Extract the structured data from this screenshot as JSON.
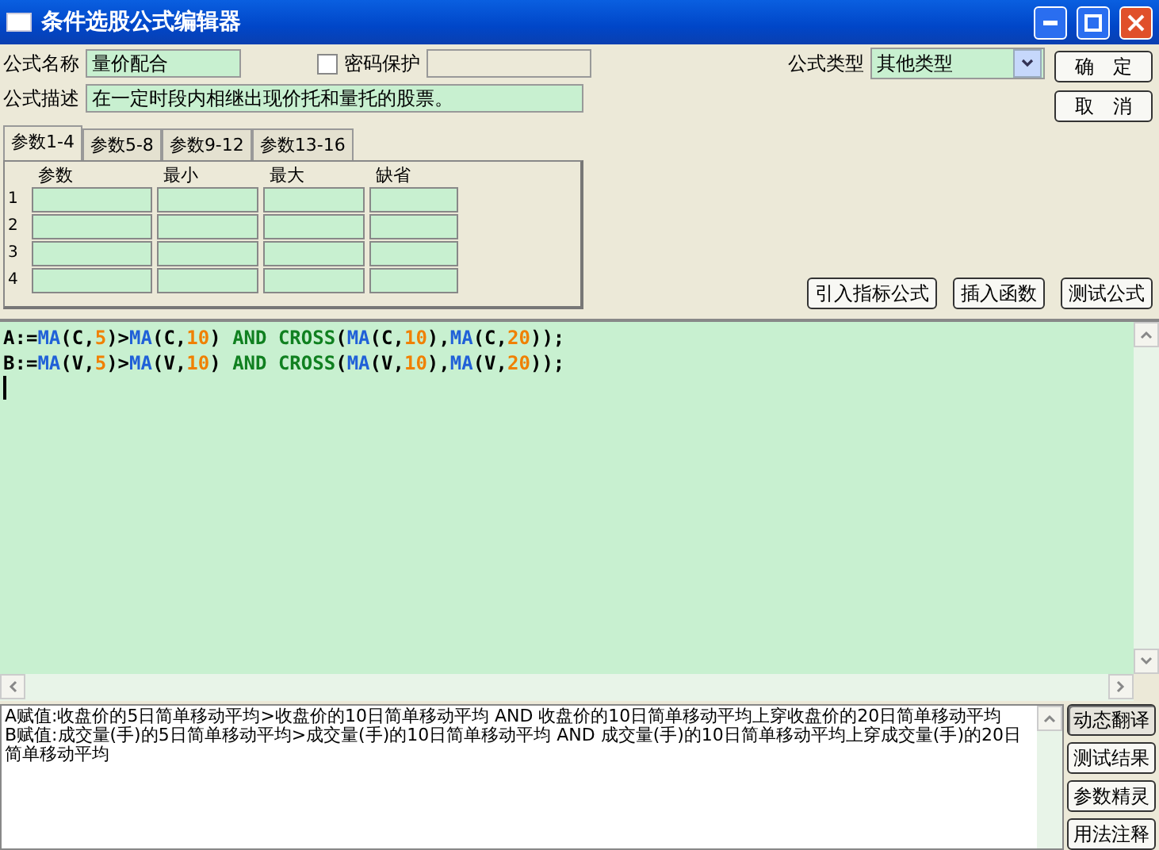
{
  "window": {
    "title": "条件选股公式编辑器"
  },
  "form": {
    "name_label": "公式名称",
    "name_value": "量价配合",
    "password": {
      "label": "密码保护",
      "checked": false
    },
    "type_label": "公式类型",
    "type_value": "其他类型",
    "desc_label": "公式描述",
    "desc_value": "在一定时段内相继出现价托和量托的股票。"
  },
  "dialog_buttons": [
    "确　定",
    "取　消"
  ],
  "tabs": [
    {
      "label": "参数1-4",
      "selected": true
    },
    {
      "label": "参数5-8",
      "selected": false
    },
    {
      "label": "参数9-12",
      "selected": false
    },
    {
      "label": "参数13-16",
      "selected": false
    }
  ],
  "params": {
    "columns": [
      "参数",
      "最小",
      "最大",
      "缺省"
    ],
    "rows": [
      "1",
      "2",
      "3",
      "4"
    ]
  },
  "tool_buttons": [
    "引入指标公式",
    "插入函数",
    "测试公式"
  ],
  "editor": {
    "lines": [
      [
        {
          "kind": "plain",
          "text": "A:="
        },
        {
          "kind": "func",
          "text": "MA"
        },
        {
          "kind": "plain",
          "text": "(C,"
        },
        {
          "kind": "number",
          "text": "5"
        },
        {
          "kind": "plain",
          "text": ")>"
        },
        {
          "kind": "func",
          "text": "MA"
        },
        {
          "kind": "plain",
          "text": "(C,"
        },
        {
          "kind": "number",
          "text": "10"
        },
        {
          "kind": "plain",
          "text": ") "
        },
        {
          "kind": "keyword",
          "text": "AND CROSS"
        },
        {
          "kind": "plain",
          "text": "("
        },
        {
          "kind": "func",
          "text": "MA"
        },
        {
          "kind": "plain",
          "text": "(C,"
        },
        {
          "kind": "number",
          "text": "10"
        },
        {
          "kind": "plain",
          "text": "),"
        },
        {
          "kind": "func",
          "text": "MA"
        },
        {
          "kind": "plain",
          "text": "(C,"
        },
        {
          "kind": "number",
          "text": "20"
        },
        {
          "kind": "plain",
          "text": "));"
        }
      ],
      [
        {
          "kind": "plain",
          "text": "B:="
        },
        {
          "kind": "func",
          "text": "MA"
        },
        {
          "kind": "plain",
          "text": "(V,"
        },
        {
          "kind": "number",
          "text": "5"
        },
        {
          "kind": "plain",
          "text": ")>"
        },
        {
          "kind": "func",
          "text": "MA"
        },
        {
          "kind": "plain",
          "text": "(V,"
        },
        {
          "kind": "number",
          "text": "10"
        },
        {
          "kind": "plain",
          "text": ") "
        },
        {
          "kind": "keyword",
          "text": "AND CROSS"
        },
        {
          "kind": "plain",
          "text": "("
        },
        {
          "kind": "func",
          "text": "MA"
        },
        {
          "kind": "plain",
          "text": "(V,"
        },
        {
          "kind": "number",
          "text": "10"
        },
        {
          "kind": "plain",
          "text": "),"
        },
        {
          "kind": "func",
          "text": "MA"
        },
        {
          "kind": "plain",
          "text": "(V,"
        },
        {
          "kind": "number",
          "text": "20"
        },
        {
          "kind": "plain",
          "text": "));"
        }
      ]
    ]
  },
  "translation": [
    "A赋值:收盘价的5日简单移动平均>收盘价的10日简单移动平均 AND 收盘价的10日简单移动平均上穿收盘价的20日简单移动平均",
    "B赋值:成交量(手)的5日简单移动平均>成交量(手)的10日简单移动平均 AND 成交量(手)的10日简单移动平均上穿成交量(手)的20日简单移动平均"
  ],
  "side_buttons": [
    {
      "label": "动态翻译",
      "selected": true
    },
    {
      "label": "测试结果",
      "selected": false
    },
    {
      "label": "参数精灵",
      "selected": false
    },
    {
      "label": "用法注释",
      "selected": false
    }
  ]
}
